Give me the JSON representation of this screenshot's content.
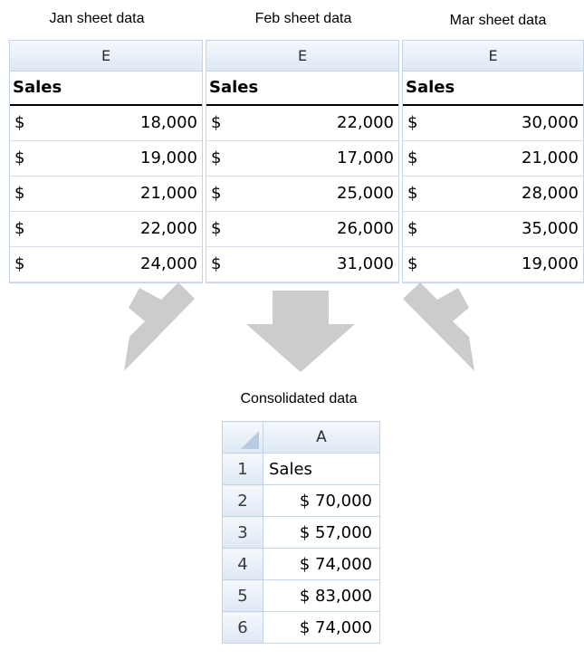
{
  "sheets": [
    {
      "caption": "Jan sheet data",
      "column": "E",
      "header": "Sales",
      "currency": "$",
      "values": [
        "18,000",
        "19,000",
        "21,000",
        "22,000",
        "24,000"
      ]
    },
    {
      "caption": "Feb sheet data",
      "column": "E",
      "header": "Sales",
      "currency": "$",
      "values": [
        "22,000",
        "17,000",
        "25,000",
        "26,000",
        "31,000"
      ]
    },
    {
      "caption": "Mar sheet data",
      "column": "E",
      "header": "Sales",
      "currency": "$",
      "values": [
        "30,000",
        "21,000",
        "28,000",
        "35,000",
        "19,000"
      ]
    }
  ],
  "consolidated": {
    "caption": "Consolidated data",
    "column": "A",
    "row_numbers": [
      "1",
      "2",
      "3",
      "4",
      "5",
      "6"
    ],
    "header": "Sales",
    "values": [
      "$ 70,000",
      "$ 57,000",
      "$ 74,000",
      "$ 83,000",
      "$ 74,000"
    ]
  },
  "colors": {
    "arrow": "#cccccc",
    "grid": "#c5d4e6",
    "header_fill": "#dde8f4"
  }
}
